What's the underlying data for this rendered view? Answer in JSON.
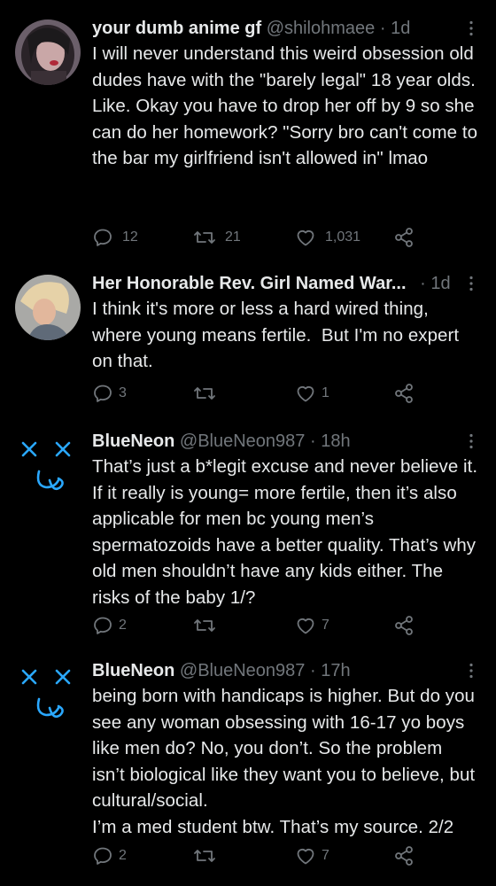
{
  "tweets": [
    {
      "name": "your dumb anime gf",
      "handle": "@shilohmaee",
      "dot": "·",
      "time": "1d",
      "text": "I will never understand this weird obsession old dudes have with the \"barely legal\" 18 year olds.\nLike. Okay you have to drop her off by 9 so she can do her homework? \"Sorry bro can't come to the bar my girlfriend isn't allowed in\" lmao",
      "replies": "12",
      "retweets": "21",
      "likes": "1,031"
    },
    {
      "name": "Her Honorable Rev. Girl Named War...",
      "handle": "",
      "dot": "·",
      "time": "1d",
      "text": "I think it's more or less a hard wired thing, where young means fertile.  But I'm no expert on that.",
      "replies": "3",
      "retweets": "",
      "likes": "1"
    },
    {
      "name": "BlueNeon",
      "handle": "@BlueNeon987",
      "dot": "·",
      "time": "18h",
      "text": "That’s just a b*legit excuse and never believe it. If it really is young= more fertile, then it’s also applicable for men bc young men’s spermatozoids have a better quality. That’s why old men shouldn’t have any kids either. The risks of the baby 1/?",
      "replies": "2",
      "retweets": "",
      "likes": "7"
    },
    {
      "name": "BlueNeon",
      "handle": "@BlueNeon987",
      "dot": "·",
      "time": "17h",
      "text": "being born with handicaps is higher. But do you see any woman obsessing with 16-17 yo boys like men do? No, you don’t. So the problem isn’t biological like they want you to believe, but cultural/social.\nI’m a med student btw. That’s my source. 2/2",
      "replies": "2",
      "retweets": "",
      "likes": "7"
    }
  ],
  "icons": {
    "reply": "reply-icon",
    "retweet": "retweet-icon",
    "like": "heart-icon",
    "share": "share-icon",
    "more": "more-options-icon"
  },
  "colors": {
    "background": "#000000",
    "text": "#e7e9ea",
    "muted": "#71767b",
    "neon": "#2aa8ff"
  }
}
